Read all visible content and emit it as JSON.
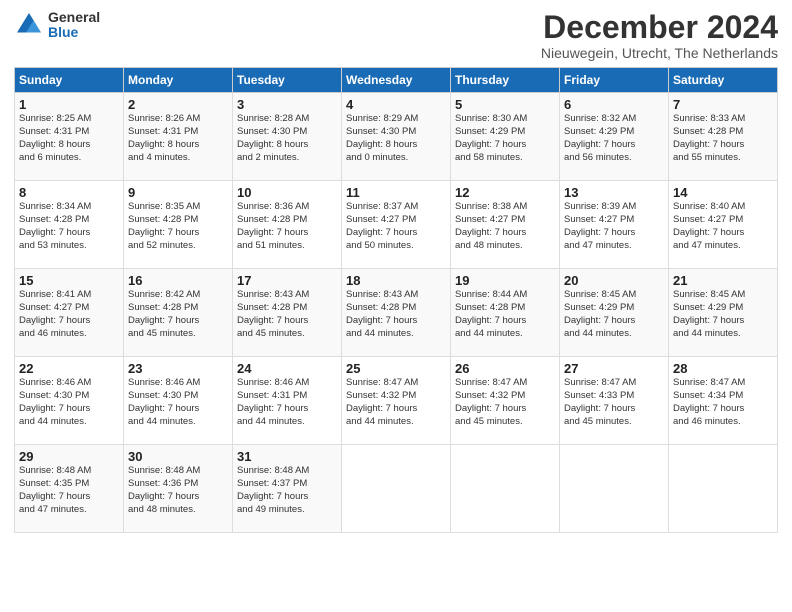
{
  "header": {
    "logo_general": "General",
    "logo_blue": "Blue",
    "title": "December 2024",
    "subtitle": "Nieuwegein, Utrecht, The Netherlands"
  },
  "days_of_week": [
    "Sunday",
    "Monday",
    "Tuesday",
    "Wednesday",
    "Thursday",
    "Friday",
    "Saturday"
  ],
  "weeks": [
    [
      {
        "day": "1",
        "info": "Sunrise: 8:25 AM\nSunset: 4:31 PM\nDaylight: 8 hours\nand 6 minutes."
      },
      {
        "day": "2",
        "info": "Sunrise: 8:26 AM\nSunset: 4:31 PM\nDaylight: 8 hours\nand 4 minutes."
      },
      {
        "day": "3",
        "info": "Sunrise: 8:28 AM\nSunset: 4:30 PM\nDaylight: 8 hours\nand 2 minutes."
      },
      {
        "day": "4",
        "info": "Sunrise: 8:29 AM\nSunset: 4:30 PM\nDaylight: 8 hours\nand 0 minutes."
      },
      {
        "day": "5",
        "info": "Sunrise: 8:30 AM\nSunset: 4:29 PM\nDaylight: 7 hours\nand 58 minutes."
      },
      {
        "day": "6",
        "info": "Sunrise: 8:32 AM\nSunset: 4:29 PM\nDaylight: 7 hours\nand 56 minutes."
      },
      {
        "day": "7",
        "info": "Sunrise: 8:33 AM\nSunset: 4:28 PM\nDaylight: 7 hours\nand 55 minutes."
      }
    ],
    [
      {
        "day": "8",
        "info": "Sunrise: 8:34 AM\nSunset: 4:28 PM\nDaylight: 7 hours\nand 53 minutes."
      },
      {
        "day": "9",
        "info": "Sunrise: 8:35 AM\nSunset: 4:28 PM\nDaylight: 7 hours\nand 52 minutes."
      },
      {
        "day": "10",
        "info": "Sunrise: 8:36 AM\nSunset: 4:28 PM\nDaylight: 7 hours\nand 51 minutes."
      },
      {
        "day": "11",
        "info": "Sunrise: 8:37 AM\nSunset: 4:27 PM\nDaylight: 7 hours\nand 50 minutes."
      },
      {
        "day": "12",
        "info": "Sunrise: 8:38 AM\nSunset: 4:27 PM\nDaylight: 7 hours\nand 48 minutes."
      },
      {
        "day": "13",
        "info": "Sunrise: 8:39 AM\nSunset: 4:27 PM\nDaylight: 7 hours\nand 47 minutes."
      },
      {
        "day": "14",
        "info": "Sunrise: 8:40 AM\nSunset: 4:27 PM\nDaylight: 7 hours\nand 47 minutes."
      }
    ],
    [
      {
        "day": "15",
        "info": "Sunrise: 8:41 AM\nSunset: 4:27 PM\nDaylight: 7 hours\nand 46 minutes."
      },
      {
        "day": "16",
        "info": "Sunrise: 8:42 AM\nSunset: 4:28 PM\nDaylight: 7 hours\nand 45 minutes."
      },
      {
        "day": "17",
        "info": "Sunrise: 8:43 AM\nSunset: 4:28 PM\nDaylight: 7 hours\nand 45 minutes."
      },
      {
        "day": "18",
        "info": "Sunrise: 8:43 AM\nSunset: 4:28 PM\nDaylight: 7 hours\nand 44 minutes."
      },
      {
        "day": "19",
        "info": "Sunrise: 8:44 AM\nSunset: 4:28 PM\nDaylight: 7 hours\nand 44 minutes."
      },
      {
        "day": "20",
        "info": "Sunrise: 8:45 AM\nSunset: 4:29 PM\nDaylight: 7 hours\nand 44 minutes."
      },
      {
        "day": "21",
        "info": "Sunrise: 8:45 AM\nSunset: 4:29 PM\nDaylight: 7 hours\nand 44 minutes."
      }
    ],
    [
      {
        "day": "22",
        "info": "Sunrise: 8:46 AM\nSunset: 4:30 PM\nDaylight: 7 hours\nand 44 minutes."
      },
      {
        "day": "23",
        "info": "Sunrise: 8:46 AM\nSunset: 4:30 PM\nDaylight: 7 hours\nand 44 minutes."
      },
      {
        "day": "24",
        "info": "Sunrise: 8:46 AM\nSunset: 4:31 PM\nDaylight: 7 hours\nand 44 minutes."
      },
      {
        "day": "25",
        "info": "Sunrise: 8:47 AM\nSunset: 4:32 PM\nDaylight: 7 hours\nand 44 minutes."
      },
      {
        "day": "26",
        "info": "Sunrise: 8:47 AM\nSunset: 4:32 PM\nDaylight: 7 hours\nand 45 minutes."
      },
      {
        "day": "27",
        "info": "Sunrise: 8:47 AM\nSunset: 4:33 PM\nDaylight: 7 hours\nand 45 minutes."
      },
      {
        "day": "28",
        "info": "Sunrise: 8:47 AM\nSunset: 4:34 PM\nDaylight: 7 hours\nand 46 minutes."
      }
    ],
    [
      {
        "day": "29",
        "info": "Sunrise: 8:48 AM\nSunset: 4:35 PM\nDaylight: 7 hours\nand 47 minutes."
      },
      {
        "day": "30",
        "info": "Sunrise: 8:48 AM\nSunset: 4:36 PM\nDaylight: 7 hours\nand 48 minutes."
      },
      {
        "day": "31",
        "info": "Sunrise: 8:48 AM\nSunset: 4:37 PM\nDaylight: 7 hours\nand 49 minutes."
      },
      {
        "day": "",
        "info": ""
      },
      {
        "day": "",
        "info": ""
      },
      {
        "day": "",
        "info": ""
      },
      {
        "day": "",
        "info": ""
      }
    ]
  ]
}
